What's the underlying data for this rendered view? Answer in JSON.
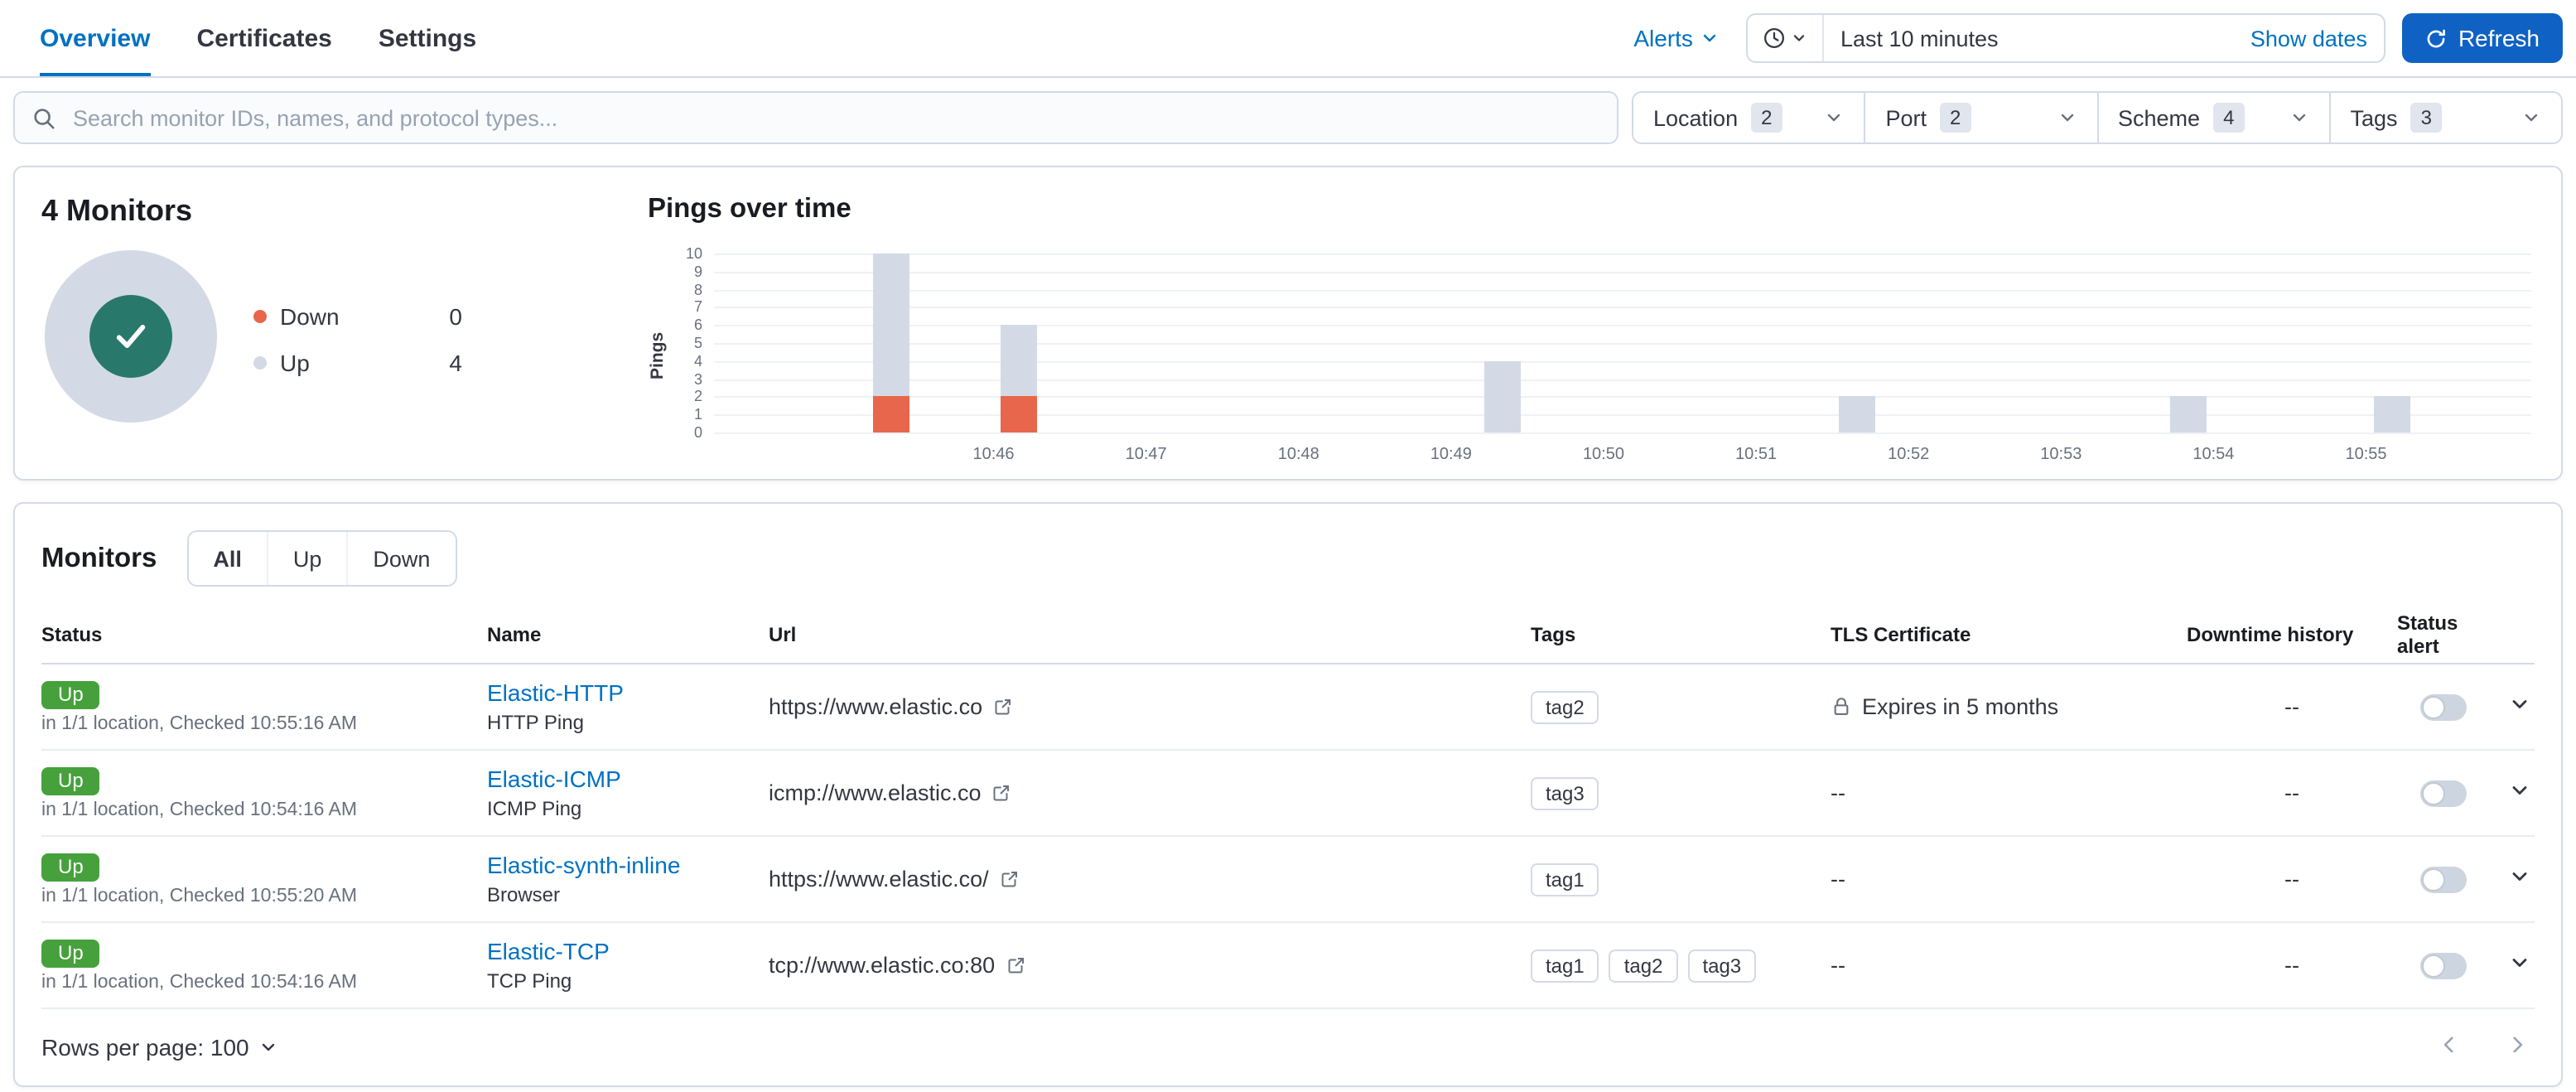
{
  "colors": {
    "accent_link": "#0071c2",
    "primary_button": "#0f62c4",
    "up_badge_green": "#46a13c",
    "donut_center_teal": "#28796b",
    "down_orange": "#e7664c",
    "up_bar_gray": "#d3dae6",
    "border": "#d3dae6"
  },
  "icons": {
    "search": "magnifier",
    "quick_select": "clock",
    "dropdown": "chevron-down",
    "refresh": "refresh-arrow",
    "external_link": "external-link",
    "tls": "padlock",
    "donut_status": "checkmark",
    "expand_row": "chevron-down",
    "pager_prev": "chevron-left",
    "pager_next": "chevron-right"
  },
  "nav": {
    "tabs": [
      {
        "label": "Overview",
        "active": true
      },
      {
        "label": "Certificates",
        "active": false
      },
      {
        "label": "Settings",
        "active": false
      }
    ],
    "alerts_label": "Alerts",
    "date_picker": {
      "value": "Last 10 minutes",
      "show_dates_label": "Show dates"
    },
    "refresh_label": "Refresh"
  },
  "filters": {
    "search_placeholder": "Search monitor IDs, names, and protocol types...",
    "items": [
      {
        "label": "Location",
        "count": "2"
      },
      {
        "label": "Port",
        "count": "2"
      },
      {
        "label": "Scheme",
        "count": "4"
      },
      {
        "label": "Tags",
        "count": "3"
      }
    ]
  },
  "summary": {
    "title": "4 Monitors",
    "legend": [
      {
        "label": "Down",
        "value": "0",
        "color": "#e7664c"
      },
      {
        "label": "Up",
        "value": "4",
        "color": "#d3dae6"
      }
    ]
  },
  "chart_data": {
    "type": "bar",
    "stacked": true,
    "title": "Pings over time",
    "ylabel": "Pings",
    "ylim": [
      0,
      10
    ],
    "y_ticks": [
      0,
      1,
      2,
      3,
      4,
      5,
      6,
      7,
      8,
      9,
      10
    ],
    "x_ticks": [
      "10:46",
      "10:47",
      "10:48",
      "10:49",
      "10:50",
      "10:51",
      "10:52",
      "10:53",
      "10:54",
      "10:55"
    ],
    "x_domain": [
      "10:44:10",
      "10:56:05"
    ],
    "series": [
      {
        "name": "Up",
        "color": "#d3dae6"
      },
      {
        "name": "Down",
        "color": "#e7664c"
      }
    ],
    "bars": [
      {
        "time": "10:45:20",
        "up": 8,
        "down": 2
      },
      {
        "time": "10:46:10",
        "up": 4,
        "down": 2
      },
      {
        "time": "10:49:20",
        "up": 4,
        "down": 0
      },
      {
        "time": "10:51:40",
        "up": 2,
        "down": 0
      },
      {
        "time": "10:53:50",
        "up": 2,
        "down": 0
      },
      {
        "time": "10:55:10",
        "up": 2,
        "down": 0
      }
    ],
    "grid": true,
    "legend_position": "none"
  },
  "monitors": {
    "title": "Monitors",
    "view_tabs": [
      "All",
      "Up",
      "Down"
    ],
    "selected_tab": "All",
    "columns": [
      "Status",
      "Name",
      "Url",
      "Tags",
      "TLS Certificate",
      "Downtime history",
      "Status alert"
    ],
    "rows": [
      {
        "status": "Up",
        "status_detail": "in 1/1 location, Checked 10:55:16 AM",
        "name": "Elastic-HTTP",
        "type": "HTTP Ping",
        "url": "https://www.elastic.co",
        "tags": [
          "tag2"
        ],
        "tls": "Expires in 5 months",
        "tls_icon": true,
        "downtime": "--",
        "alert_enabled": false
      },
      {
        "status": "Up",
        "status_detail": "in 1/1 location, Checked 10:54:16 AM",
        "name": "Elastic-ICMP",
        "type": "ICMP Ping",
        "url": "icmp://www.elastic.co",
        "tags": [
          "tag3"
        ],
        "tls": "--",
        "tls_icon": false,
        "downtime": "--",
        "alert_enabled": false
      },
      {
        "status": "Up",
        "status_detail": "in 1/1 location, Checked 10:55:20 AM",
        "name": "Elastic-synth-inline",
        "type": "Browser",
        "url": "https://www.elastic.co/",
        "tags": [
          "tag1"
        ],
        "tls": "--",
        "tls_icon": false,
        "downtime": "--",
        "alert_enabled": false
      },
      {
        "status": "Up",
        "status_detail": "in 1/1 location, Checked 10:54:16 AM",
        "name": "Elastic-TCP",
        "type": "TCP Ping",
        "url": "tcp://www.elastic.co:80",
        "tags": [
          "tag1",
          "tag2",
          "tag3"
        ],
        "tls": "--",
        "tls_icon": false,
        "downtime": "--",
        "alert_enabled": false
      }
    ],
    "rows_per_page_label": "Rows per page: 100"
  }
}
